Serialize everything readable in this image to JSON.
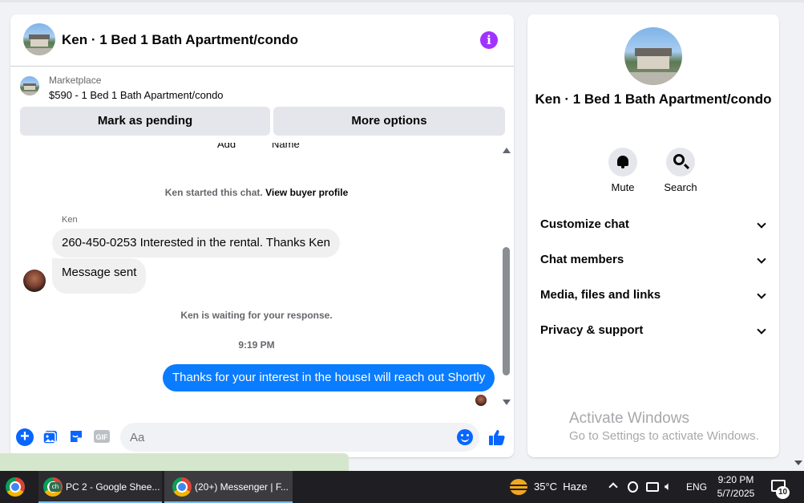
{
  "chat_header": {
    "title": "Ken · 1 Bed 1 Bath Apartment/condo",
    "info_icon": "info-icon"
  },
  "marketplace": {
    "label": "Marketplace",
    "item": "$590 - 1 Bed 1 Bath Apartment/condo"
  },
  "buttons": {
    "mark_pending": "Mark as pending",
    "more_options": "More options"
  },
  "cutoff": {
    "add": "Add",
    "name": "Name"
  },
  "messages": {
    "system_started_prefix": "Ken started this chat.",
    "view_buyer_profile": "View buyer profile",
    "sender": "Ken",
    "incoming": [
      "260-450-0253 Interested in the rental.  Thanks Ken",
      "Message sent"
    ],
    "waiting": "Ken is waiting for your response.",
    "timestamp": "9:19 PM",
    "outgoing": "Thanks for your interest in the houseI will reach out Shortly"
  },
  "composer": {
    "placeholder": "Aa",
    "icons": [
      "plus-icon",
      "photo-icon",
      "sticker-icon",
      "gif-icon",
      "emoji-icon",
      "like-icon"
    ],
    "gif_label": "GIF",
    "accent": "#0866ff"
  },
  "sidebar": {
    "title": "Ken · 1 Bed 1 Bath Apartment/condo",
    "actions": [
      {
        "label": "Mute",
        "icon": "bell-icon"
      },
      {
        "label": "Search",
        "icon": "search-icon"
      }
    ],
    "sections": [
      "Customize chat",
      "Chat members",
      "Media, files and links",
      "Privacy & support"
    ]
  },
  "watermark": {
    "line1": "Activate Windows",
    "line2": "Go to Settings to activate Windows."
  },
  "taskbar": {
    "items": [
      {
        "badge": "ch",
        "label": "PC 2 - Google Shee..."
      },
      {
        "label": "(20+) Messenger | F..."
      }
    ],
    "weather": "35°C  Haze",
    "language": "ENG",
    "time": "9:20 PM",
    "date": "5/7/2025",
    "notifications": "10"
  }
}
